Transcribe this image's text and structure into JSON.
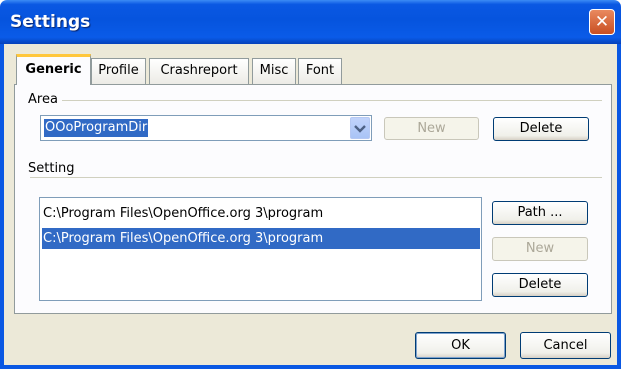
{
  "window": {
    "title": "Settings"
  },
  "tabs": [
    {
      "label": "Generic",
      "active": true
    },
    {
      "label": "Profile",
      "active": false
    },
    {
      "label": "Crashreport",
      "active": false
    },
    {
      "label": "Misc",
      "active": false
    },
    {
      "label": "Font",
      "active": false
    }
  ],
  "area": {
    "label": "Area",
    "selected": "OOoProgramDir",
    "new_label": "New",
    "delete_label": "Delete"
  },
  "setting": {
    "label": "Setting",
    "items": [
      {
        "text": "C:\\Program Files\\OpenOffice.org 3\\program",
        "selected": false
      },
      {
        "text": "C:\\Program Files\\OpenOffice.org 3\\program",
        "selected": true
      }
    ],
    "path_label": "Path ...",
    "new_label": "New",
    "delete_label": "Delete"
  },
  "footer": {
    "ok_label": "OK",
    "cancel_label": "Cancel"
  },
  "colors": {
    "titlebar": "#0a58e3",
    "selection": "#316ac5",
    "client": "#ece9d8",
    "tab_highlight": "#ffc73c"
  },
  "icons": {
    "close": "close-icon",
    "dropdown": "chevron-down-icon"
  }
}
